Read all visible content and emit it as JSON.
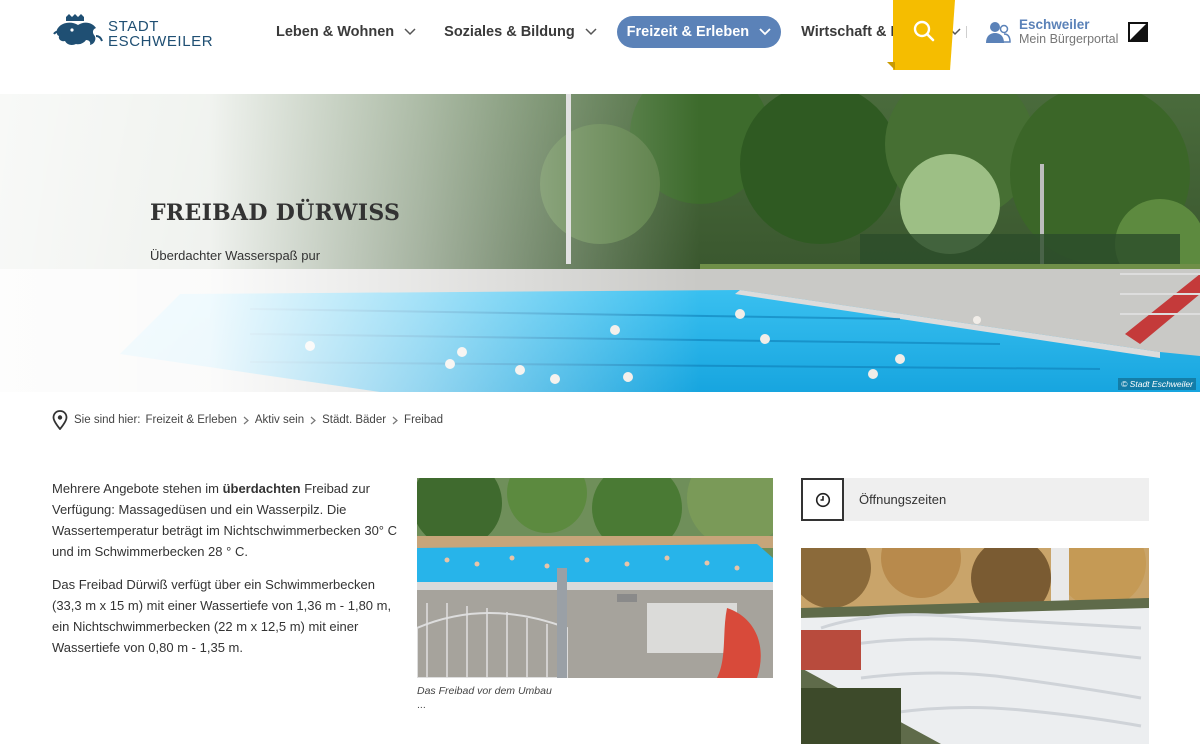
{
  "header": {
    "logo": {
      "line1": "STADT",
      "line2": "ESCHWEILER"
    },
    "nav": [
      {
        "label": "Leben & Wohnen",
        "active": false
      },
      {
        "label": "Soziales & Bildung",
        "active": false
      },
      {
        "label": "Freizeit & Erleben",
        "active": true
      },
      {
        "label": "Wirtschaft & Handel",
        "active": false
      }
    ],
    "portal": {
      "name": "Eschweiler",
      "sub": "Mein Bürgerportal"
    },
    "icons": [
      "logo-lion-icon",
      "search-icon",
      "user-icon",
      "contrast-icon",
      "chevron-down-icon"
    ]
  },
  "hero": {
    "title": "FREIBAD DÜRWISS",
    "subtitle": "Überdachter Wasserspaß pur",
    "credit": "© Stadt Eschweiler"
  },
  "breadcrumb": {
    "prefix": "Sie sind hier:",
    "items": [
      "Freizeit & Erleben",
      "Aktiv sein",
      "Städt. Bäder",
      "Freibad"
    ]
  },
  "content": {
    "p1_before": "Mehrere Angebote stehen im ",
    "p1_bold": "überdachten",
    "p1_after": " Freibad zur Verfügung: Massagedüsen und ein Wasserpilz. Die Wassertemperatur beträgt im Nichtschwimmerbecken 30° C und im Schwimmerbecken 28 ° C.",
    "p2": "Das Freibad Dürwiß verfügt über ein Schwimmerbecken (33,3 m x 15 m) mit einer Wassertiefe von 1,36 m - 1,80 m, ein Nichtschwimmerbecken (22 m x 12,5 m) mit einer Wassertiefe von 0,80 m - 1,35 m."
  },
  "figure": {
    "caption": "Das Freibad vor dem Umbau",
    "more": "..."
  },
  "sidebar": {
    "hours_label": "Öffnungszeiten"
  },
  "colors": {
    "brand_blue": "#1f4f73",
    "nav_active": "#5b82b8",
    "search_yellow": "#f5bd00",
    "pool_blue": "#1fb3e8"
  }
}
